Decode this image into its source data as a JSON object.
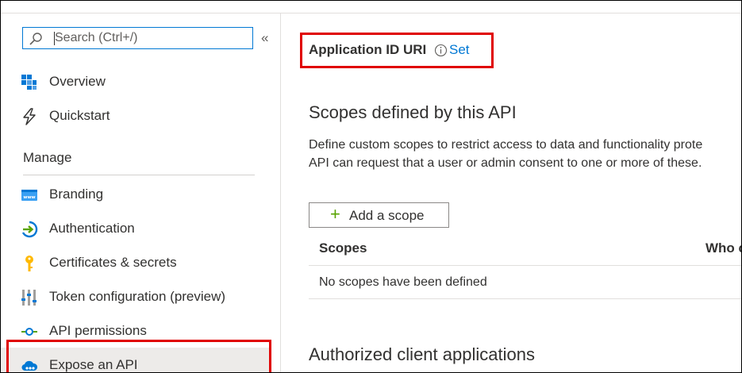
{
  "search": {
    "placeholder": "Search (Ctrl+/)",
    "collapse_glyph": "«"
  },
  "sidebar": {
    "items_top": [
      {
        "label": "Overview",
        "icon": "overview-grid-icon"
      },
      {
        "label": "Quickstart",
        "icon": "lightning-icon"
      }
    ],
    "section_title": "Manage",
    "items_manage": [
      {
        "label": "Branding",
        "icon": "www-icon"
      },
      {
        "label": "Authentication",
        "icon": "authentication-icon"
      },
      {
        "label": "Certificates & secrets",
        "icon": "key-icon"
      },
      {
        "label": "Token configuration (preview)",
        "icon": "token-bars-icon"
      },
      {
        "label": "API permissions",
        "icon": "api-permissions-icon"
      },
      {
        "label": "Expose an API",
        "icon": "cloud-icon",
        "selected": true
      }
    ]
  },
  "main": {
    "app_id_uri_label": "Application ID URI",
    "set_link": "Set",
    "scopes_title": "Scopes defined by this API",
    "scopes_desc_line1": "Define custom scopes to restrict access to data and functionality prote",
    "scopes_desc_line2": "API can request that a user or admin consent to one or more of these.",
    "add_scope_label": "Add a scope",
    "table": {
      "headers": [
        "Scopes",
        "Who c"
      ],
      "empty_text": "No scopes have been defined"
    },
    "authorized_title": "Authorized client applications"
  },
  "colors": {
    "accent": "#0078d4",
    "highlight_box": "#e00000",
    "selected_bg": "#edebe9",
    "plus": "#57a300"
  }
}
